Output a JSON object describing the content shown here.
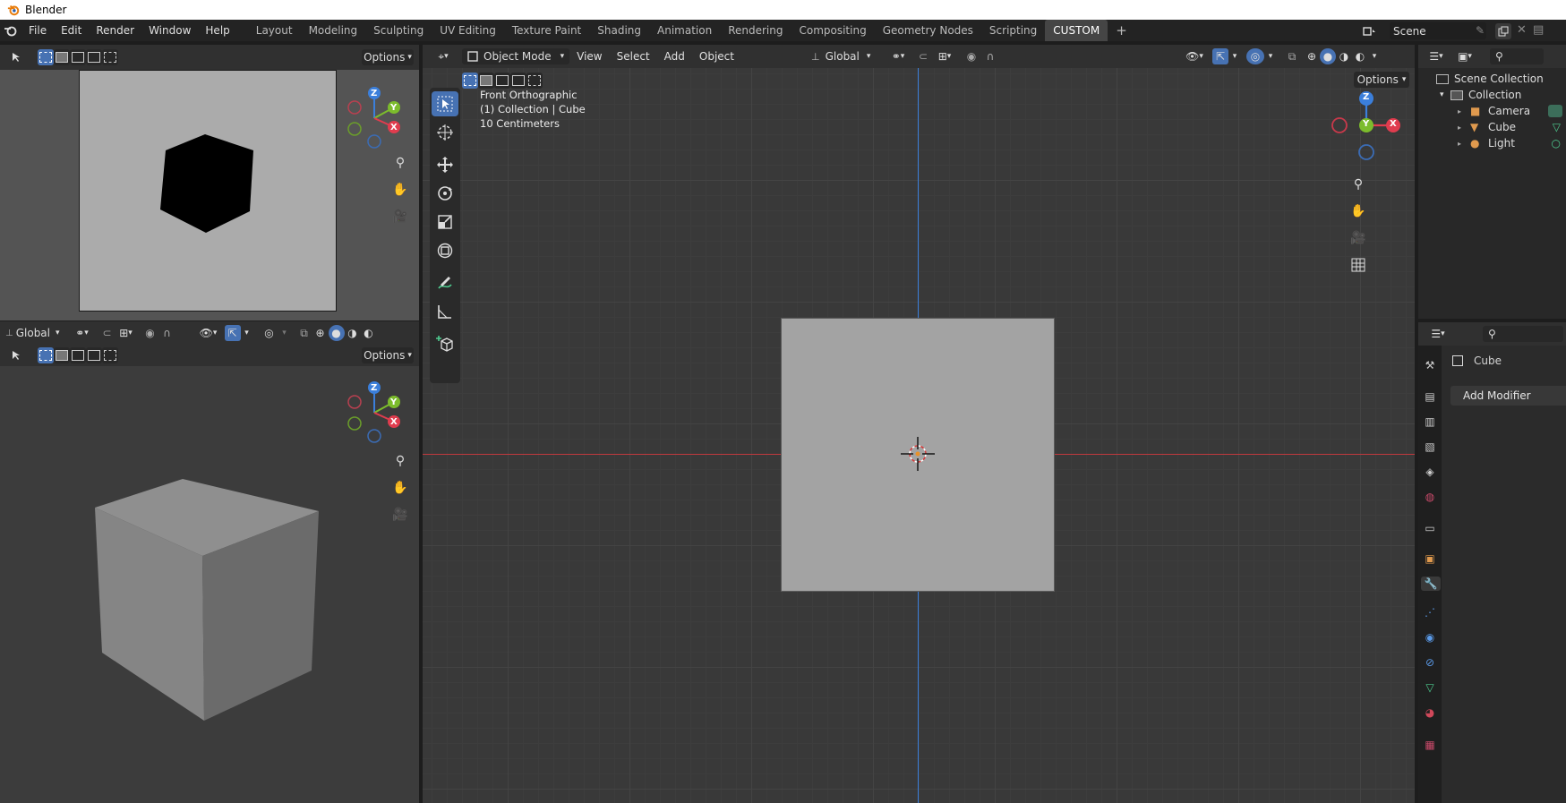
{
  "window": {
    "title": "Blender"
  },
  "menu": [
    "File",
    "Edit",
    "Render",
    "Window",
    "Help"
  ],
  "workspaces": [
    {
      "label": "Layout"
    },
    {
      "label": "Modeling"
    },
    {
      "label": "Sculpting"
    },
    {
      "label": "UV Editing"
    },
    {
      "label": "Texture Paint"
    },
    {
      "label": "Shading"
    },
    {
      "label": "Animation"
    },
    {
      "label": "Rendering"
    },
    {
      "label": "Compositing"
    },
    {
      "label": "Geometry Nodes"
    },
    {
      "label": "Scripting"
    },
    {
      "label": "CUSTOM"
    }
  ],
  "active_workspace": "CUSTOM",
  "scene": {
    "name": "Scene"
  },
  "main_header": {
    "mode": "Object Mode",
    "menus": [
      "View",
      "Select",
      "Add",
      "Object"
    ],
    "orientation": "Global",
    "options_label": "Options"
  },
  "main_overlay": {
    "view_name": "Front Orthographic",
    "collection_info": "(1) Collection | Cube",
    "scale": "10 Centimeters"
  },
  "left_top": {
    "options_label": "Options"
  },
  "left_bottom": {
    "orientation": "Global",
    "options_label": "Options"
  },
  "gizmo_axes": {
    "x": "X",
    "y": "Y",
    "z": "Z"
  },
  "outliner": {
    "root": "Scene Collection",
    "collection": "Collection",
    "items": [
      {
        "label": "Camera",
        "icon": "camera-icon",
        "color": "#e09a4e"
      },
      {
        "label": "Cube",
        "icon": "mesh-icon",
        "color": "#e09a4e"
      },
      {
        "label": "Light",
        "icon": "light-icon",
        "color": "#e09a4e"
      }
    ]
  },
  "properties": {
    "object_name": "Cube",
    "add_modifier_label": "Add Modifier"
  },
  "colors": {
    "axis_x": "#e03c4e",
    "axis_y": "#7cbc2c",
    "axis_z": "#3b7fdb",
    "accent": "#4772b3",
    "active_tab": "#454545"
  }
}
